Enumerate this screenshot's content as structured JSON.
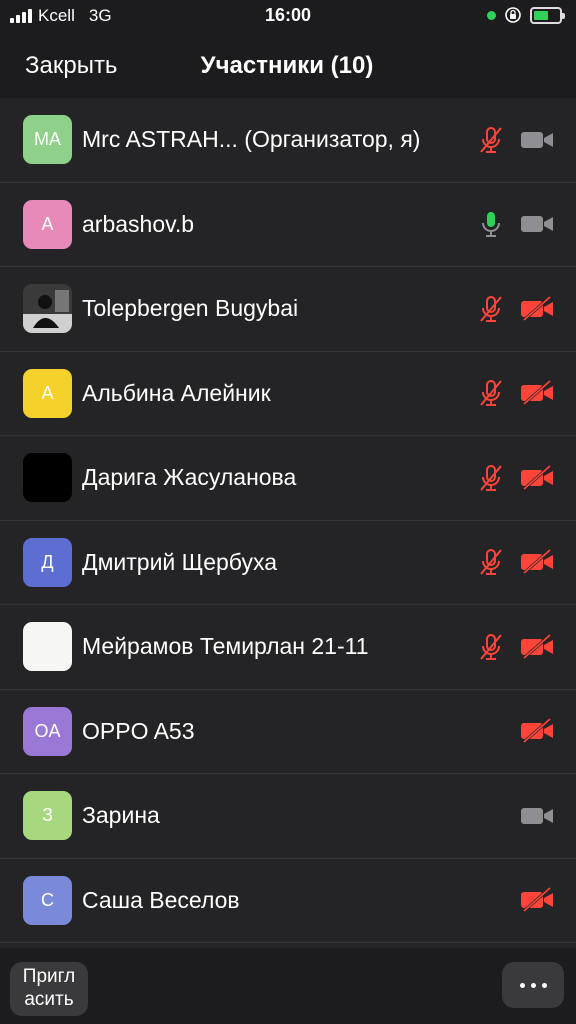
{
  "status_bar": {
    "carrier": "Kcell",
    "network": "3G",
    "time": "16:00",
    "icons": [
      "signal-icon",
      "mic-in-use-dot-icon",
      "orientation-lock-icon",
      "battery-charging-icon"
    ]
  },
  "header": {
    "close_label": "Закрыть",
    "title": "Участники (10)"
  },
  "colors": {
    "background": "#242426",
    "bar": "#1c1c1e",
    "muted_red": "#ff453a",
    "active_green": "#30d158",
    "icon_gray": "#8e8e93"
  },
  "participants": [
    {
      "initials": "MA",
      "avatar_color": "#8fd18a",
      "name": "Mrc ASTRAH...   (Организатор, я)",
      "mic": "muted",
      "video": "off-gray"
    },
    {
      "initials": "A",
      "avatar_color": "#e88ab9",
      "name": "arbashov.b",
      "mic": "active",
      "video": "off-gray"
    },
    {
      "initials": "",
      "avatar_color": "#2a2a2a",
      "name": "Tolepbergen Bugybai",
      "mic": "muted",
      "video": "off-red"
    },
    {
      "initials": "A",
      "avatar_color": "#f5d22b",
      "name": "Альбина Алейник",
      "mic": "muted",
      "video": "off-red"
    },
    {
      "initials": "",
      "avatar_color": "#000000",
      "name": "Дарига Жасуланова",
      "mic": "muted",
      "video": "off-red"
    },
    {
      "initials": "Д",
      "avatar_color": "#5c6fd1",
      "name": "Дмитрий Щербуха",
      "mic": "muted",
      "video": "off-red"
    },
    {
      "initials": "",
      "avatar_color": "#f7f7f5",
      "name": "Мейрамов Темирлан 21-11",
      "mic": "muted",
      "video": "off-red"
    },
    {
      "initials": "OA",
      "avatar_color": "#9a78d6",
      "name": "OPPO A53",
      "mic": "none",
      "video": "off-red"
    },
    {
      "initials": "З",
      "avatar_color": "#a7d87f",
      "name": "Зарина",
      "mic": "none",
      "video": "off-gray"
    },
    {
      "initials": "C",
      "avatar_color": "#7b8ad8",
      "name": "Саша Веселов",
      "mic": "none",
      "video": "off-red"
    }
  ],
  "bottom": {
    "invite_label_line1": "Пригл",
    "invite_label_line2": "асить",
    "more_icon": "more-dots-icon"
  }
}
